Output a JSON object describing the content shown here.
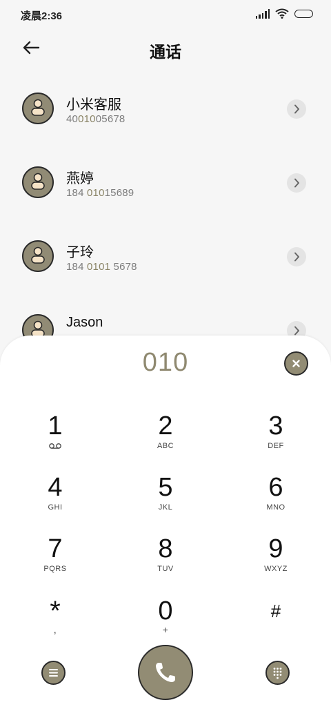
{
  "status_bar": {
    "time": "凌晨2:36"
  },
  "header": {
    "title": "通话"
  },
  "contacts": [
    {
      "name": "小米客服",
      "number_pre": "40",
      "number_match": "010",
      "number_post": "05678"
    },
    {
      "name": "燕婷",
      "number_pre": "184 ",
      "number_match": "010",
      "number_post": "15689"
    },
    {
      "name": "子玲",
      "number_pre": "184 ",
      "number_match": "0101",
      "number_post": " 5678"
    },
    {
      "name": "Jason",
      "number_pre": "",
      "number_match": "",
      "number_post": ""
    }
  ],
  "dialpad": {
    "input": "010",
    "keys": [
      {
        "digit": "1",
        "letters": ""
      },
      {
        "digit": "2",
        "letters": "ABC"
      },
      {
        "digit": "3",
        "letters": "DEF"
      },
      {
        "digit": "4",
        "letters": "GHI"
      },
      {
        "digit": "5",
        "letters": "JKL"
      },
      {
        "digit": "6",
        "letters": "MNO"
      },
      {
        "digit": "7",
        "letters": "PQRS"
      },
      {
        "digit": "8",
        "letters": "TUV"
      },
      {
        "digit": "9",
        "letters": "WXYZ"
      },
      {
        "digit": "*",
        "letters": ","
      },
      {
        "digit": "0",
        "letters": "+"
      },
      {
        "digit": "#",
        "letters": ""
      }
    ]
  },
  "colors": {
    "accent": "#928c74",
    "highlight": "#8a8466",
    "background": "#f6f6f6"
  }
}
